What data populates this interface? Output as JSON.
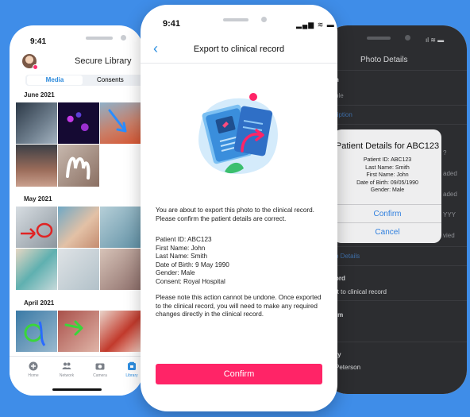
{
  "left_phone": {
    "time": "9:41",
    "title": "Secure Library",
    "segments": [
      "Media",
      "Consents",
      "D"
    ],
    "sections": [
      "June 2021",
      "May 2021",
      "April 2021"
    ],
    "tabs": [
      "Home",
      "Network",
      "Camera",
      "Library"
    ]
  },
  "center_phone": {
    "time": "9:41",
    "status_icons": "▂▄▆ ≋ ▬",
    "back": "‹",
    "title": "Export to clinical record",
    "intro": "You are about to export this photo to the clinical record. Please confirm the patient details are correct.",
    "patient_lines": [
      "Patient ID: ABC123",
      "First Name: John",
      "Last Name: Smith",
      "Date of Birth: 9 May 1990",
      "Gender: Male",
      "Consent: Royal Hospital"
    ],
    "note": "Please note this action cannot be undone. Once exported to the clinical record, you will need to make any required changes directly in the clinical record.",
    "confirm_label": "Confirm"
  },
  "right_phone": {
    "status_icons": "ıl ≋ ▬",
    "title": "Photo Details",
    "dim_texts": [
      "n",
      "ole",
      "ription",
      "?",
      "aded",
      "aded",
      "YYY",
      "vied",
      "o Details",
      "ord",
      "rt to clinical record",
      "rm",
      "ry",
      "Peterson"
    ],
    "alert": {
      "title": "Patient Details for ABC123",
      "lines": [
        "Patient ID: ABC123",
        "Last Name: Smith",
        "First Name: John",
        "Date of Birth: 09/05/1990",
        "Gender: Male"
      ],
      "confirm": "Confirm",
      "cancel": "Cancel"
    }
  },
  "colors": {
    "background": "#3f8de8",
    "accent_pink": "#ff2467",
    "link_blue": "#2c8fe0"
  }
}
